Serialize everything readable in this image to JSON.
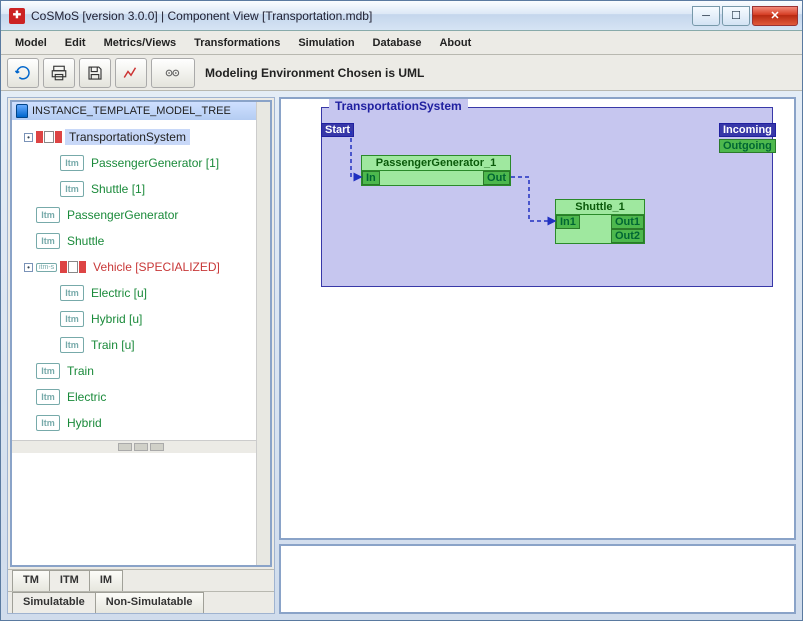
{
  "title": "CoSMoS [version 3.0.0] | Component View [Transportation.mdb]",
  "menu": [
    "Model",
    "Edit",
    "Metrics/Views",
    "Transformations",
    "Simulation",
    "Database",
    "About"
  ],
  "toolbar_label": "Modeling Environment Chosen is UML",
  "tree": {
    "root": "INSTANCE_TEMPLATE_MODEL_TREE",
    "items": [
      {
        "label": "TransportationSystem",
        "type": "comp",
        "sel": true,
        "cls": "blk",
        "indent": 0,
        "tog": "−"
      },
      {
        "label": "PassengerGenerator [1]",
        "type": "itm",
        "cls": "green",
        "indent": 1
      },
      {
        "label": "Shuttle [1]",
        "type": "itm",
        "cls": "green",
        "indent": 1
      },
      {
        "label": "PassengerGenerator",
        "type": "itm",
        "cls": "green",
        "indent": 0
      },
      {
        "label": "Shuttle",
        "type": "itm",
        "cls": "green",
        "indent": 0
      },
      {
        "label": "Vehicle [SPECIALIZED]",
        "type": "comps",
        "cls": "red",
        "indent": 0,
        "tog": "−"
      },
      {
        "label": "Electric [u]",
        "type": "itm",
        "cls": "green",
        "indent": 1
      },
      {
        "label": "Hybrid [u]",
        "type": "itm",
        "cls": "green",
        "indent": 1
      },
      {
        "label": "Train [u]",
        "type": "itm",
        "cls": "green",
        "indent": 1
      },
      {
        "label": "Train",
        "type": "itm",
        "cls": "green",
        "indent": 0
      },
      {
        "label": "Electric",
        "type": "itm",
        "cls": "green",
        "indent": 0
      },
      {
        "label": "Hybrid",
        "type": "itm",
        "cls": "green",
        "indent": 0
      }
    ]
  },
  "bottom_tabs": [
    "TM",
    "ITM",
    "IM"
  ],
  "sim_tabs": [
    "Simulatable",
    "Non-Simulatable"
  ],
  "diagram": {
    "system": "TransportationSystem",
    "start": "Start",
    "incoming": "Incoming",
    "outgoing": "Outgoing",
    "comp1": {
      "name": "PassengerGenerator_1",
      "in": "In",
      "out": "Out"
    },
    "comp2": {
      "name": "Shuttle_1",
      "in": "In1",
      "out1": "Out1",
      "out2": "Out2"
    }
  }
}
